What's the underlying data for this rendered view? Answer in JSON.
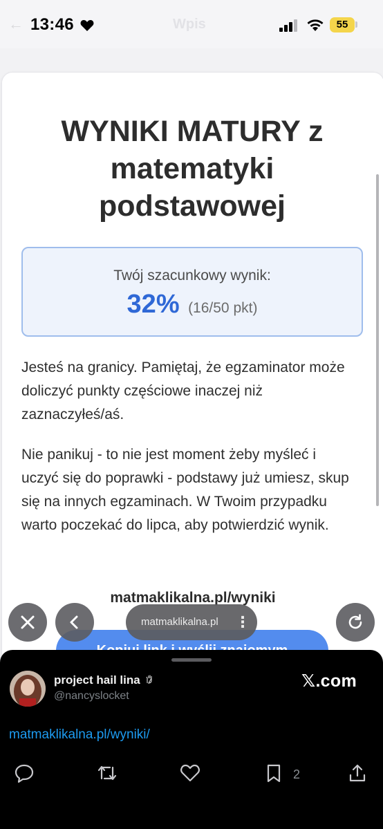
{
  "status_bar": {
    "time": "13:46",
    "battery": "55",
    "faint_title": "Wpis"
  },
  "card": {
    "title": "WYNIKI MATURY z matematyki podstawowej",
    "result_label": "Twój szacunkowy wynik:",
    "result_percent": "32%",
    "result_points": "(16/50 pkt)",
    "paragraph_1": "Jesteś na granicy. Pamiętaj, że egzaminator może doliczyć punkty częściowe inaczej niż zaznaczyłeś/aś.",
    "paragraph_2": "Nie panikuj - to nie jest moment żeby myśleć i uczyć się do poprawki - podstawy już umiesz, skup się na innych egzaminach. W Twoim przypadku warto poczekać do lipca, aby potwierdzić wynik.",
    "site_link": "matmaklikalna.pl/wyniki",
    "copy_button": "Kopiuj link i wyślij znajomym"
  },
  "browser": {
    "url": "matmaklikalna.pl",
    "more_glyph": "⋮"
  },
  "tweet": {
    "user_name": "project hail lina",
    "user_handle": "@nancyslocket",
    "source": "𝕏.com",
    "link": "matmaklikalna.pl/wyniki/",
    "bookmark_count": "2"
  },
  "icons": [
    "heart-icon",
    "signal-icon",
    "wifi-icon",
    "close-icon",
    "back-icon",
    "reload-icon",
    "reply-icon",
    "retweet-icon",
    "like-icon",
    "bookmark-icon",
    "share-icon"
  ],
  "colors": {
    "accent": "#2f68d6",
    "result_border": "#9fbdec",
    "link": "#1d9bf0",
    "battery": "#f4d54b"
  }
}
